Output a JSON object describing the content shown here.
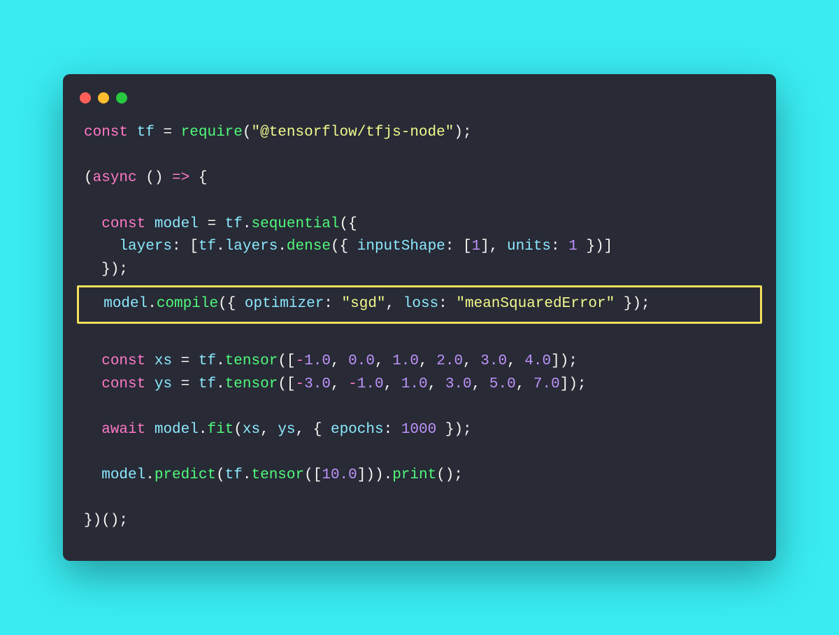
{
  "window": {
    "dots": [
      "red",
      "yellow",
      "green"
    ]
  },
  "code": {
    "l1": {
      "const": "const",
      "tf": "tf",
      "eq": " = ",
      "require": "require",
      "lp": "(",
      "str": "\"@tensorflow/tfjs-node\"",
      "rp": ");"
    },
    "l3": {
      "lp": "(",
      "async": "async",
      "arrow": " () => {",
      "mid": " "
    },
    "l5": {
      "indent": "  ",
      "const": "const",
      "model": " model",
      "eq": " = ",
      "tf": "tf",
      "dot": ".",
      "seq": "sequential",
      "open": "({"
    },
    "l6": {
      "indent": "    ",
      "layers": "layers",
      "colon": ": [",
      "tf": "tf",
      "dot1": ".",
      "layersId": "layers",
      "dot2": ".",
      "dense": "dense",
      "open": "({ ",
      "inputShape": "inputShape",
      "c1": ": [",
      "one": "1",
      "c2": "], ",
      "units": "units",
      "c3": ": ",
      "one2": "1",
      "close": " })]"
    },
    "l7": {
      "indent": "  ",
      "close": "});"
    },
    "hl": {
      "indent": "  ",
      "model": "model",
      "dot": ".",
      "compile": "compile",
      "open": "({ ",
      "optimizer": "optimizer",
      "c1": ": ",
      "sgd": "\"sgd\"",
      "comma": ", ",
      "loss": "loss",
      "c2": ": ",
      "mse": "\"meanSquaredError\"",
      "close": " });"
    },
    "l11": {
      "indent": "  ",
      "const": "const",
      "xs": " xs",
      "eq": " = ",
      "tf": "tf",
      "dot": ".",
      "tensor": "tensor",
      "open": "([",
      "v1": "-1.0",
      "v2": "0.0",
      "v3": "1.0",
      "v4": "2.0",
      "v5": "3.0",
      "v6": "4.0",
      "close": "]);",
      "sep": ", "
    },
    "l12": {
      "indent": "  ",
      "const": "const",
      "ys": " ys",
      "eq": " = ",
      "tf": "tf",
      "dot": ".",
      "tensor": "tensor",
      "open": "([",
      "v1": "-3.0",
      "v2": "-1.0",
      "v3": "1.0",
      "v4": "3.0",
      "v5": "5.0",
      "v6": "7.0",
      "close": "]);",
      "sep": ", "
    },
    "l14": {
      "indent": "  ",
      "await": "await",
      "model": " model",
      "dot": ".",
      "fit": "fit",
      "open": "(",
      "xs": "xs",
      "c1": ", ",
      "ys": "ys",
      "c2": ", { ",
      "epochs": "epochs",
      "c3": ": ",
      "n": "1000",
      "close": " });"
    },
    "l16": {
      "indent": "  ",
      "model": "model",
      "dot1": ".",
      "predict": "predict",
      "open": "(",
      "tf": "tf",
      "dot2": ".",
      "tensor": "tensor",
      "open2": "([",
      "n": "10.0",
      "close2": "]))",
      "dot3": ".",
      "print": "print",
      "end": "();"
    },
    "l18": {
      "close": "})();"
    }
  }
}
